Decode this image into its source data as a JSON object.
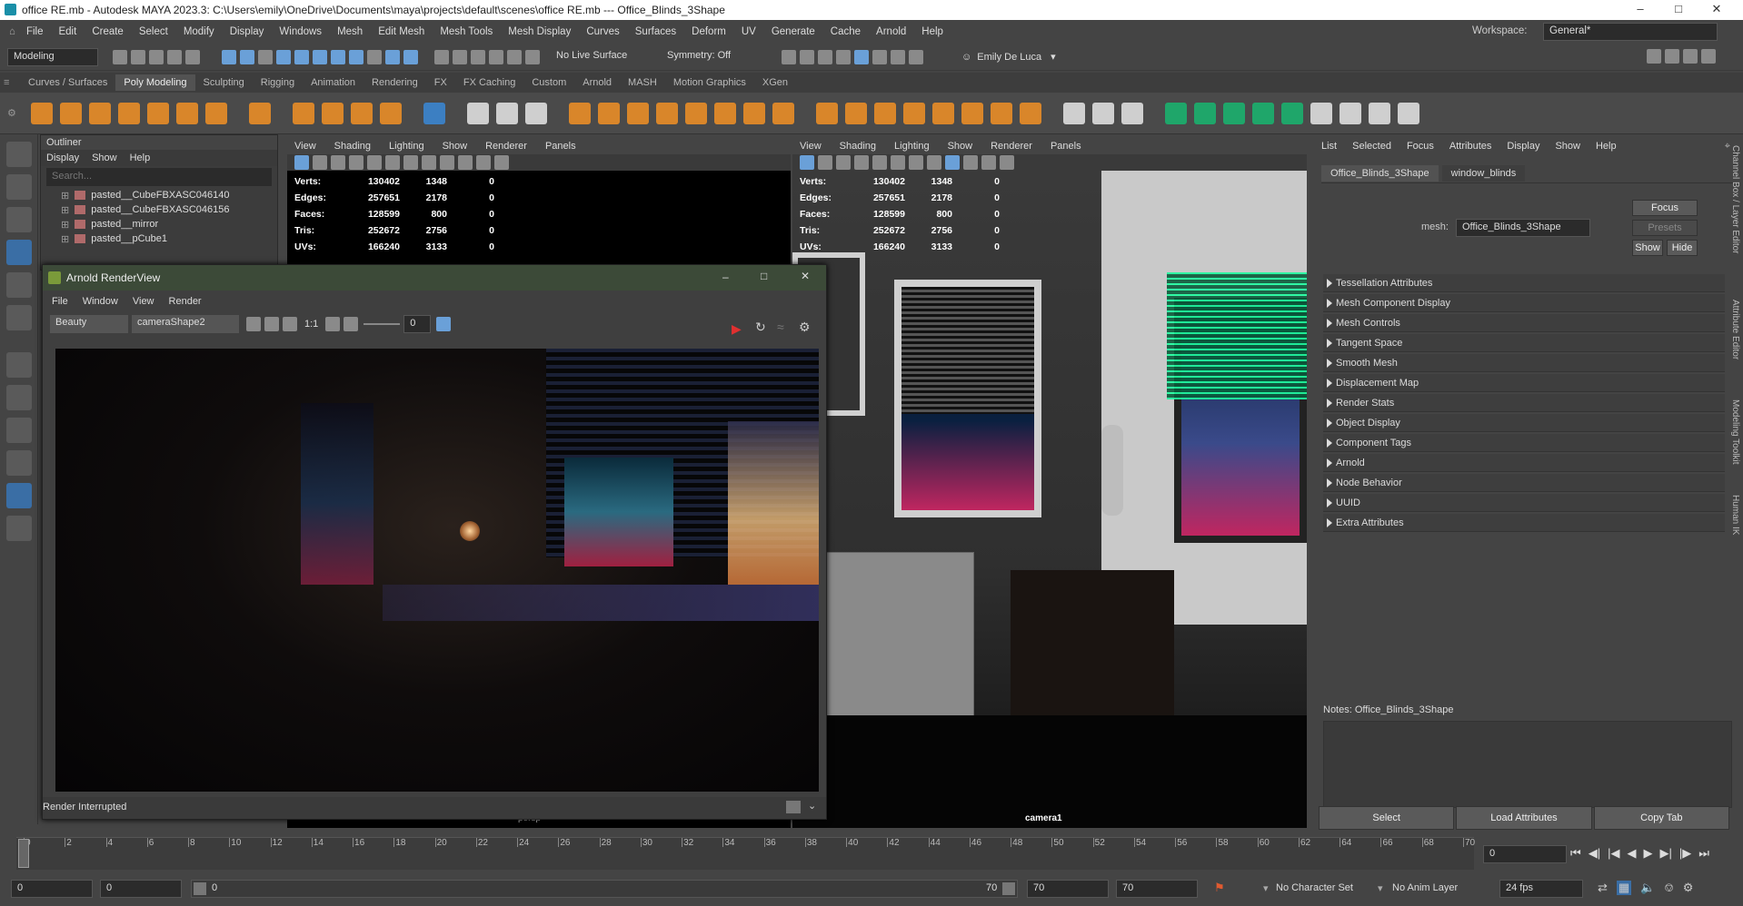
{
  "window": {
    "title": "office RE.mb - Autodesk MAYA 2023.3: C:\\Users\\emily\\OneDrive\\Documents\\maya\\projects\\default\\scenes\\office RE.mb  ---  Office_Blinds_3Shape"
  },
  "menubar": [
    "File",
    "Edit",
    "Create",
    "Select",
    "Modify",
    "Display",
    "Windows",
    "Mesh",
    "Edit Mesh",
    "Mesh Tools",
    "Mesh Display",
    "Curves",
    "Surfaces",
    "Deform",
    "UV",
    "Generate",
    "Cache",
    "Arnold",
    "Help"
  ],
  "workspace": {
    "label": "Workspace:",
    "value": "General*"
  },
  "statusline": {
    "mode": "Modeling",
    "live_surface": "No Live Surface",
    "symmetry": "Symmetry: Off",
    "user": "Emily De Luca"
  },
  "shelf_tabs": [
    "Curves / Surfaces",
    "Poly Modeling",
    "Sculpting",
    "Rigging",
    "Animation",
    "Rendering",
    "FX",
    "FX Caching",
    "Custom",
    "Arnold",
    "MASH",
    "Motion Graphics",
    "XGen"
  ],
  "shelf_active": "Poly Modeling",
  "outliner": {
    "title": "Outliner",
    "menu": [
      "Display",
      "Show",
      "Help"
    ],
    "search_placeholder": "Search...",
    "items": [
      "pasted__CubeFBXASC046140",
      "pasted__CubeFBXASC046156",
      "pasted__mirror",
      "pasted__pCube1"
    ]
  },
  "viewport_menu": [
    "View",
    "Shading",
    "Lighting",
    "Show",
    "Renderer",
    "Panels"
  ],
  "hud": {
    "rows": [
      [
        "Verts:",
        "130402",
        "1348",
        "0"
      ],
      [
        "Edges:",
        "257651",
        "2178",
        "0"
      ],
      [
        "Faces:",
        "128599",
        "800",
        "0"
      ],
      [
        "Tris:",
        "252672",
        "2756",
        "0"
      ],
      [
        "UVs:",
        "166240",
        "3133",
        "0"
      ]
    ]
  },
  "viewport_left": {
    "camera": "persp"
  },
  "viewport_right": {
    "camera": "camera1"
  },
  "renderview": {
    "title": "Arnold RenderView",
    "menu": [
      "File",
      "Window",
      "View",
      "Render"
    ],
    "aov": "Beauty",
    "camera": "cameraShape2",
    "ratio": "1:1",
    "exposure": "0",
    "status": "Render Interrupted"
  },
  "attr_editor": {
    "menu": [
      "List",
      "Selected",
      "Focus",
      "Attributes",
      "Display",
      "Show",
      "Help"
    ],
    "tabs": [
      "Office_Blinds_3Shape",
      "window_blinds"
    ],
    "mesh_label": "mesh:",
    "mesh_value": "Office_Blinds_3Shape",
    "focus": "Focus",
    "presets": "Presets",
    "show": "Show",
    "hide": "Hide",
    "sections": [
      "Tessellation Attributes",
      "Mesh Component Display",
      "Mesh Controls",
      "Tangent Space",
      "Smooth Mesh",
      "Displacement Map",
      "Render Stats",
      "Object Display",
      "Component Tags",
      "Arnold",
      "Node Behavior",
      "UUID",
      "Extra Attributes"
    ],
    "notes": "Notes:  Office_Blinds_3Shape",
    "buttons": [
      "Select",
      "Load Attributes",
      "Copy Tab"
    ]
  },
  "side_tabs": [
    "Channel Box / Layer Editor",
    "Attribute Editor",
    "Modeling Toolkit",
    "Human IK"
  ],
  "timeline": {
    "ticks": [
      "0",
      "2",
      "4",
      "6",
      "8",
      "10",
      "12",
      "14",
      "16",
      "18",
      "20",
      "22",
      "24",
      "26",
      "28",
      "30",
      "32",
      "34",
      "36",
      "38",
      "40",
      "42",
      "44",
      "46",
      "48",
      "50",
      "52",
      "54",
      "56",
      "58",
      "60",
      "62",
      "64",
      "66",
      "68",
      "70"
    ],
    "current": "0"
  },
  "range": {
    "start": "0",
    "anim_start": "0",
    "range_start": "0",
    "range_end": "70",
    "anim_end": "70",
    "end": "70",
    "char_set": "No Character Set",
    "anim_layer": "No Anim Layer",
    "fps": "24 fps"
  }
}
